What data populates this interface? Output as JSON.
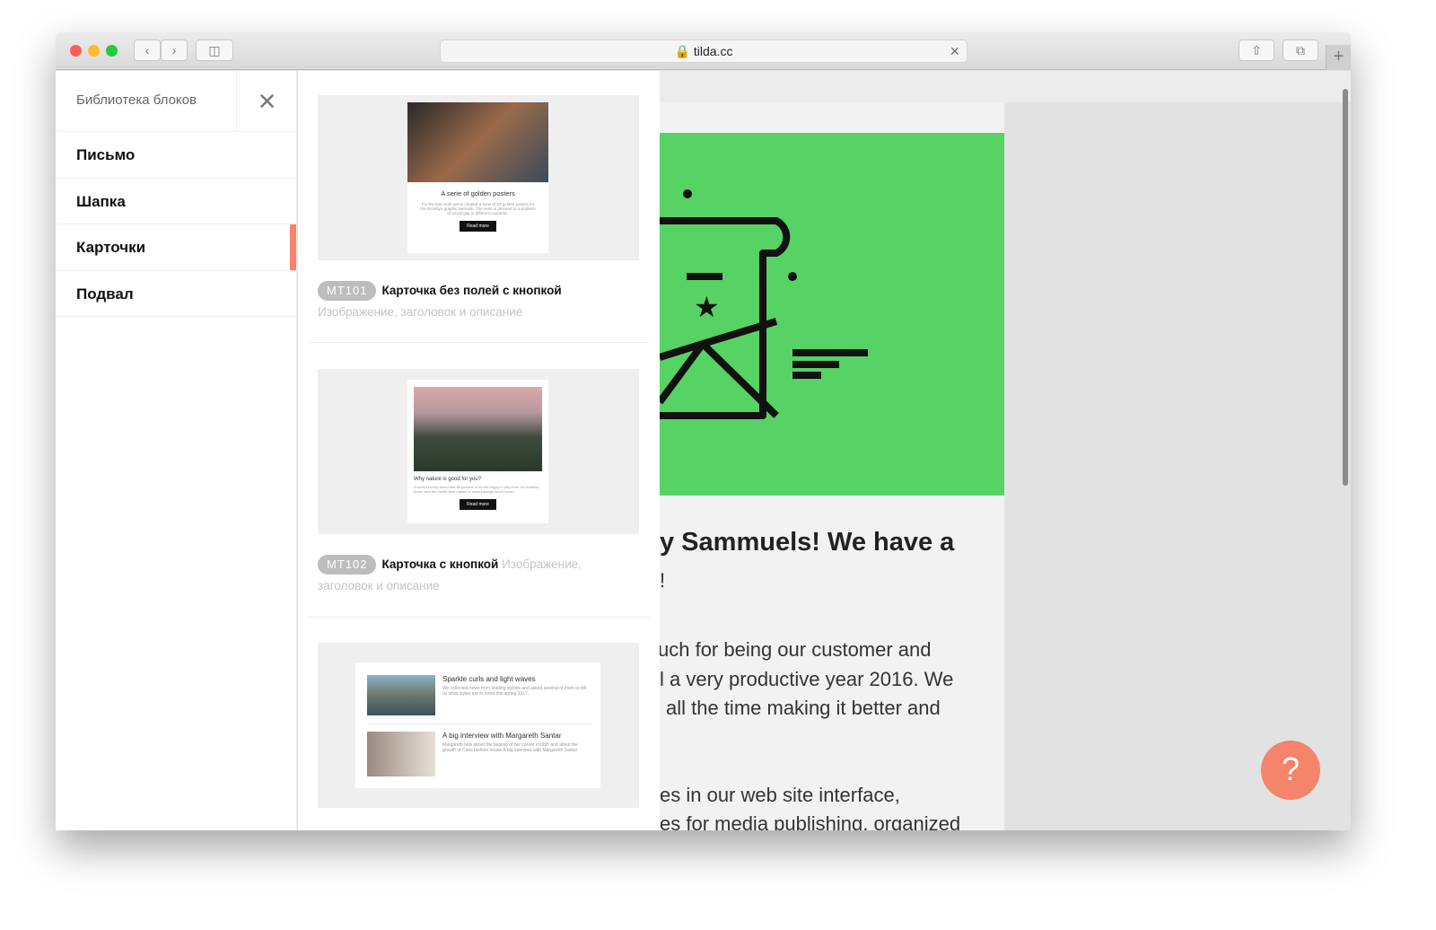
{
  "browser": {
    "url": "tilda.cc"
  },
  "sidebar": {
    "title": "Библиотека блоков",
    "items": [
      {
        "label": "Письмо"
      },
      {
        "label": "Шапка"
      },
      {
        "label": "Карточки",
        "active": true
      },
      {
        "label": "Подвал"
      }
    ]
  },
  "cards": [
    {
      "code": "MT101",
      "name": "Карточка без полей с кнопкой",
      "desc": "Изображение, заголовок и описание",
      "preview": {
        "title": "A serie of golden posters",
        "text": "For the last moth we've created a serie of 24 golden posess for the Brooklyn graphic biennale. The serie is devoted to a problem of social gap in different countries.",
        "button": "Read more"
      }
    },
    {
      "code": "MT102",
      "name": "Карточка с кнопкой",
      "desc": "Изображение, заголовок и описание",
      "preview": {
        "title": "Why nature is good for you?",
        "text": "A recent survey found that 88 percent of us are happy to pay more for healthier foods, and the health food market is unsurprisingly set to boom.",
        "button": "Read more"
      }
    },
    {
      "preview": {
        "items": [
          {
            "title": "Sparkle curls and light waves",
            "text": "We collected news from leading stylists and asked several of them to tell us what styles are in trend this spring 2017."
          },
          {
            "title": "A big interview with Margareth Santar",
            "text": "Margareth tells about the beginig of her career in1995 and about the growth of Caso fashion house.A big interview with Margareth Santar"
          }
        ]
      }
    }
  ],
  "email": {
    "heading": "y Sammuels! We have a",
    "heading2": "!",
    "paragraph": [
      "uch for being our customer and",
      "l a very productive year 2016. We",
      "all the time making it better and"
    ],
    "paragraph2": [
      "es in our web site interface,",
      "es for media publishing, organized"
    ]
  },
  "help": {
    "label": "?"
  },
  "colors": {
    "accent": "#f4846a",
    "green": "#57d264"
  }
}
